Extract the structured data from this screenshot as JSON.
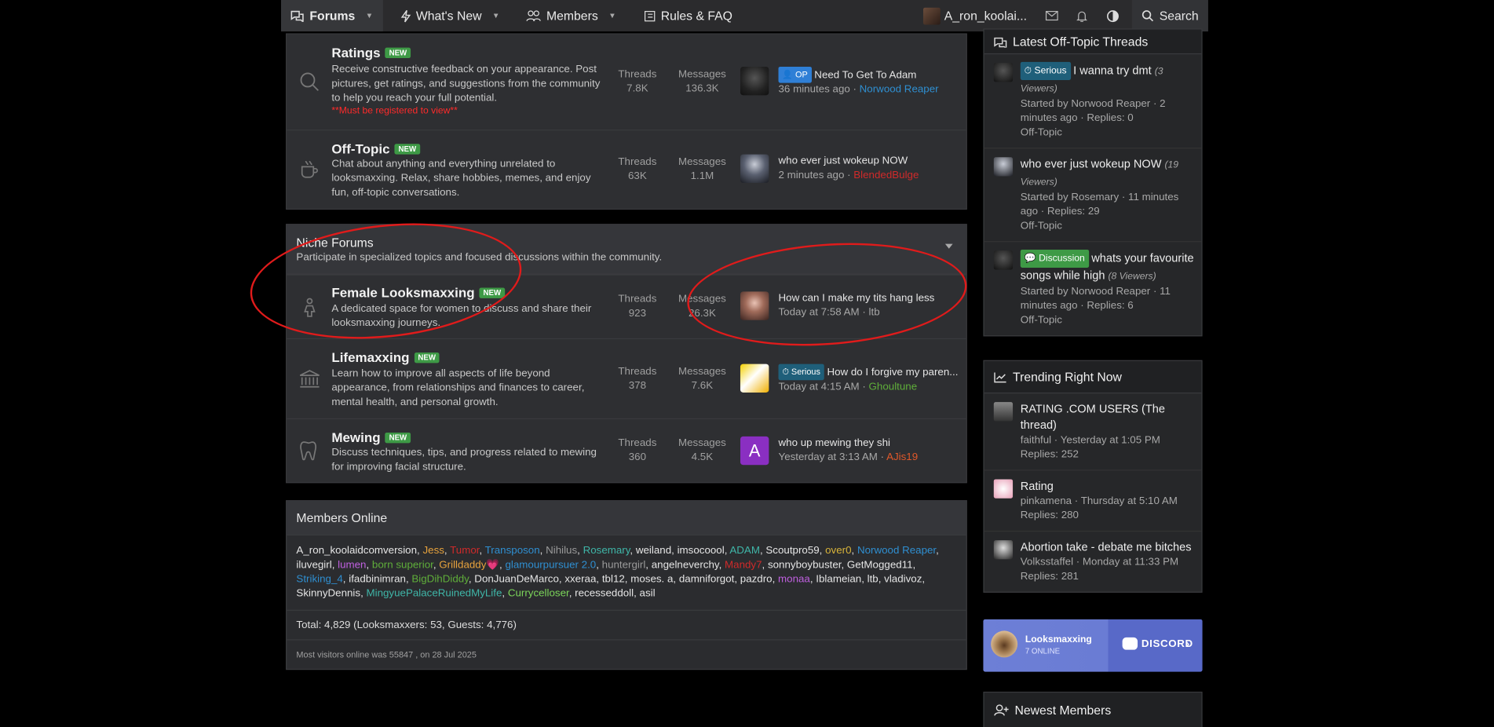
{
  "nav": {
    "forums": "Forums",
    "whats_new": "What's New",
    "members": "Members",
    "rules": "Rules & FAQ",
    "user": "A_ron_koolai...",
    "search": "Search"
  },
  "main_forums": [
    {
      "title": "Ratings",
      "badge": "NEW",
      "desc": "Receive constructive feedback on your appearance. Post pictures, get ratings, and suggestions from the community to help you reach your full potential.",
      "warn": "**Must be registered to view**",
      "threads_label": "Threads",
      "threads": "7.8K",
      "messages_label": "Messages",
      "messages": "136.3K",
      "prefix": "OP",
      "last_title": "Need To Get To Adam",
      "last_time": "36 minutes ago",
      "last_user": "Norwood Reaper",
      "user_color": "#2f8fd1"
    },
    {
      "title": "Off-Topic",
      "badge": "NEW",
      "desc": "Chat about anything and everything unrelated to looksmaxxing. Relax, share hobbies, memes, and enjoy fun, off-topic conversations.",
      "threads_label": "Threads",
      "threads": "63K",
      "messages_label": "Messages",
      "messages": "1.1M",
      "last_title": "who ever just wokeup NOW",
      "last_time": "2 minutes ago",
      "last_user": "BlendedBulge",
      "user_color": "#d02a2a"
    }
  ],
  "niche": {
    "title": "Niche Forums",
    "desc": "Participate in specialized topics and focused discussions within the community.",
    "forums": [
      {
        "title": "Female Looksmaxxing",
        "badge": "NEW",
        "desc": "A dedicated space for women to discuss and share their looksmaxxing journeys.",
        "threads_label": "Threads",
        "threads": "923",
        "messages_label": "Messages",
        "messages": "26.3K",
        "last_title": "How can I make my tits hang less",
        "last_time": "Today at 7:58 AM",
        "last_user": "ltb",
        "user_color": "#a8a8a8"
      },
      {
        "title": "Lifemaxxing",
        "badge": "NEW",
        "desc": "Learn how to improve all aspects of life beyond appearance, from relationships and finances to career, mental health, and personal growth.",
        "threads_label": "Threads",
        "threads": "378",
        "messages_label": "Messages",
        "messages": "7.6K",
        "prefix": "Serious",
        "last_title": "How do I forgive my paren...",
        "last_time": "Today at 4:15 AM",
        "last_user": "Ghoultune",
        "user_color": "#5fae3a"
      },
      {
        "title": "Mewing",
        "badge": "NEW",
        "desc": "Discuss techniques, tips, and progress related to mewing for improving facial structure.",
        "threads_label": "Threads",
        "threads": "360",
        "messages_label": "Messages",
        "messages": "4.5K",
        "avatar_letter": "A",
        "last_title": "who up mewing they shi",
        "last_time": "Yesterday at 3:13 AM",
        "last_user": "AJis19",
        "user_color": "#e0582a"
      }
    ]
  },
  "members_online": {
    "title": "Members Online",
    "members": [
      [
        "A_ron_koolaidcomversion",
        "#e6e6e6"
      ],
      [
        "Jess",
        "#e8a33d"
      ],
      [
        "Tumor",
        "#d02a2a"
      ],
      [
        "Transposon",
        "#2f8fd1"
      ],
      [
        "Nihilus",
        "#9a9a9a"
      ],
      [
        "Rosemary",
        "#3fb6a8"
      ],
      [
        "weiland",
        "#e6e6e6"
      ],
      [
        "imsocoool",
        "#e6e6e6"
      ],
      [
        "ADAM",
        "#3fb6a8"
      ],
      [
        "Scoutpro59",
        "#e6e6e6"
      ],
      [
        "over0",
        "#d8b43a"
      ],
      [
        "Norwood Reaper",
        "#2f8fd1"
      ],
      [
        "iluvegirl",
        "#e6e6e6"
      ],
      [
        "lumen",
        "#c060e0"
      ],
      [
        "born superior",
        "#5fae3a"
      ],
      [
        "Grilldaddy💗",
        "#e8a33d"
      ],
      [
        "glamourpursuer 2.0",
        "#2f8fd1"
      ],
      [
        "huntergirl",
        "#9a9a9a"
      ],
      [
        "angelneverchy",
        "#e6e6e6"
      ],
      [
        "Mandy7",
        "#d02a2a"
      ],
      [
        "sonnyboybuster",
        "#e6e6e6"
      ],
      [
        "GetMogged11",
        "#e6e6e6"
      ],
      [
        "Striking_4",
        "#2f8fd1"
      ],
      [
        "ifadbinimran",
        "#e6e6e6"
      ],
      [
        "BigDihDiddy",
        "#5fae3a"
      ],
      [
        "DonJuanDeMarco",
        "#e6e6e6"
      ],
      [
        "xxeraa",
        "#e6e6e6"
      ],
      [
        "tbl12",
        "#e6e6e6"
      ],
      [
        "moses. a",
        "#e6e6e6"
      ],
      [
        "damniforgot",
        "#e6e6e6"
      ],
      [
        "pazdro",
        "#e6e6e6"
      ],
      [
        "monaa",
        "#c060e0"
      ],
      [
        "Iblameian",
        "#e6e6e6"
      ],
      [
        "ltb",
        "#e6e6e6"
      ],
      [
        "vladivoz",
        "#e6e6e6"
      ],
      [
        "SkinnyDennis",
        "#e6e6e6"
      ],
      [
        "MingyuePalaceRuinedMyLife",
        "#3fb6a8"
      ],
      [
        "Currycelloser",
        "#7cd65a"
      ],
      [
        "recesseddoll",
        "#e6e6e6"
      ],
      [
        "asil",
        "#e6e6e6"
      ]
    ],
    "total": "Total: 4,829 (Looksmaxxers: 53, Guests: 4,776)",
    "record": "Most visitors online was 55847 , on 28 Jul 2025"
  },
  "offtopic": {
    "title": "Latest Off-Topic Threads",
    "items": [
      {
        "prefix": "Serious",
        "title": "I wanna try dmt",
        "viewers": "(3 Viewers)",
        "meta": "Started by Norwood Reaper · 2 minutes ago · Replies: 0",
        "forum": "Off-Topic"
      },
      {
        "title": "who ever just wokeup NOW",
        "viewers": "(19 Viewers)",
        "meta": "Started by Rosemary · 11 minutes ago · Replies: 29",
        "forum": "Off-Topic"
      },
      {
        "prefix": "Discussion",
        "title": "whats your favourite songs while high",
        "viewers": "(8 Viewers)",
        "meta": "Started by Norwood Reaper · 11 minutes ago · Replies: 6",
        "forum": "Off-Topic"
      }
    ]
  },
  "trending": {
    "title": "Trending Right Now",
    "items": [
      {
        "title": "RATING .COM USERS (The thread)",
        "meta": "faithful · Yesterday at 1:05 PM",
        "replies": "Replies: 252"
      },
      {
        "title": "Rating",
        "meta": "pinkamena · Thursday at 5:10 AM",
        "replies": "Replies: 280"
      },
      {
        "title": "Abortion take - debate me bitches",
        "meta": "Volksstaffel · Monday at 11:33 PM",
        "replies": "Replies: 281"
      }
    ]
  },
  "discord": {
    "name": "Looksmaxxing",
    "online": "7 ONLINE",
    "brand": "DISCORD"
  },
  "newest": {
    "title": "Newest Members"
  }
}
